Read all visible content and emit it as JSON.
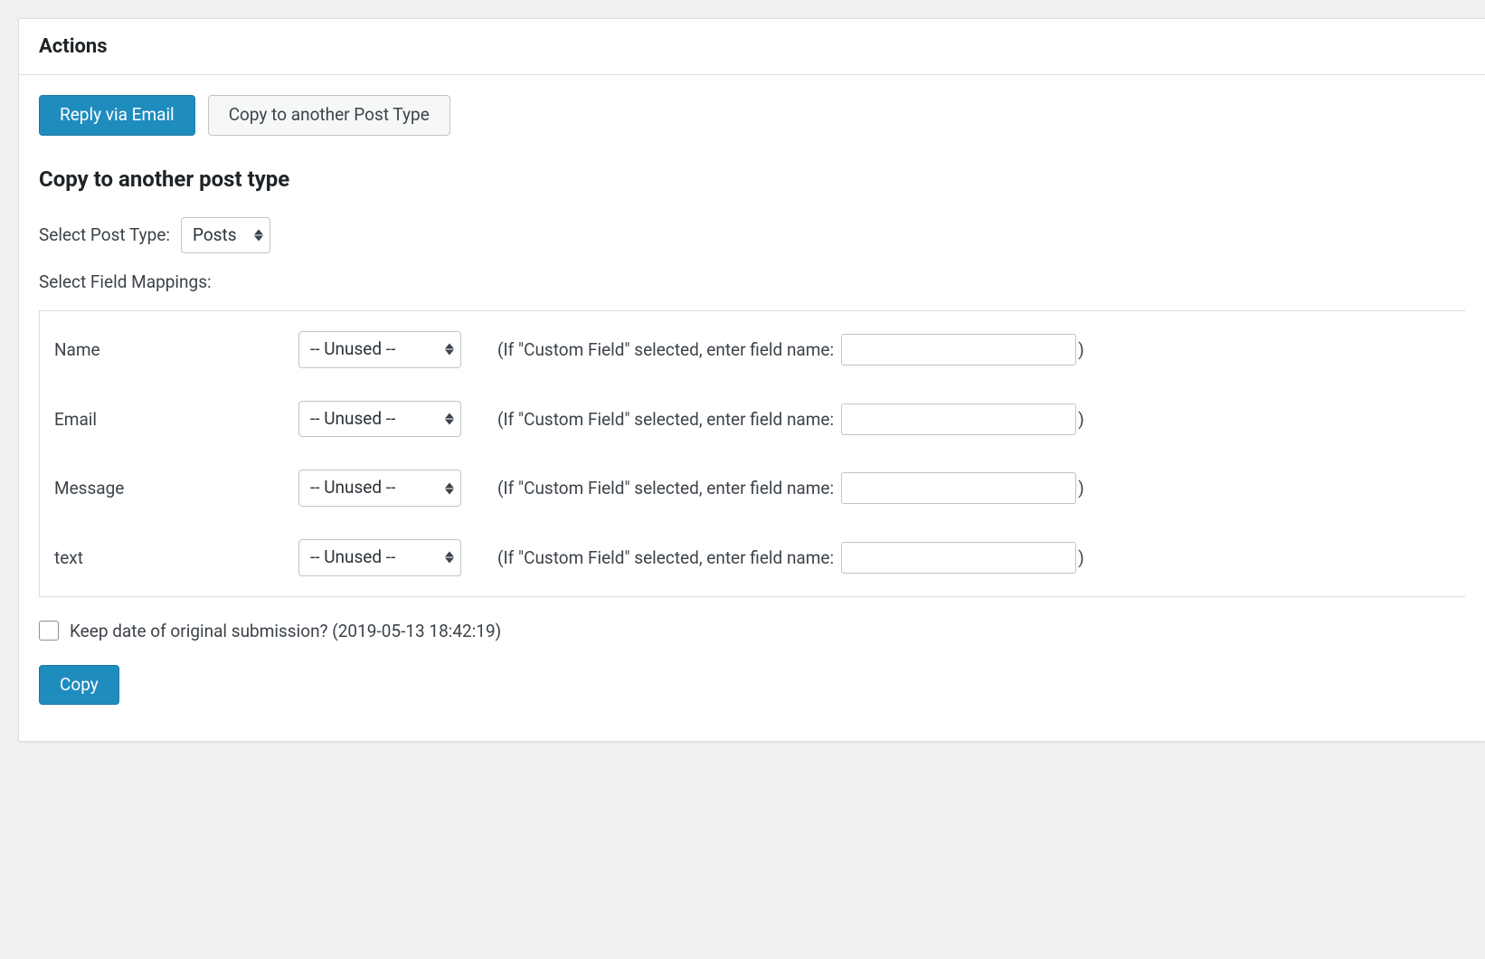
{
  "header": {
    "title": "Actions"
  },
  "buttons": {
    "reply": "Reply via Email",
    "copy_tab": "Copy to another Post Type",
    "copy_submit": "Copy"
  },
  "section": {
    "title": "Copy to another post type",
    "select_post_type_label": "Select Post Type:",
    "post_type_value": "Posts",
    "select_mappings_label": "Select Field Mappings:",
    "keep_date_label": "Keep date of original submission? (2019-05-13 18:42:19)"
  },
  "mapping_defaults": {
    "unused": "-- Unused --",
    "hint_prefix": "(If \"Custom Field\" selected, enter field name:",
    "hint_suffix": ")"
  },
  "mappings": [
    {
      "label": "Name"
    },
    {
      "label": "Email"
    },
    {
      "label": "Message"
    },
    {
      "label": "text"
    }
  ]
}
